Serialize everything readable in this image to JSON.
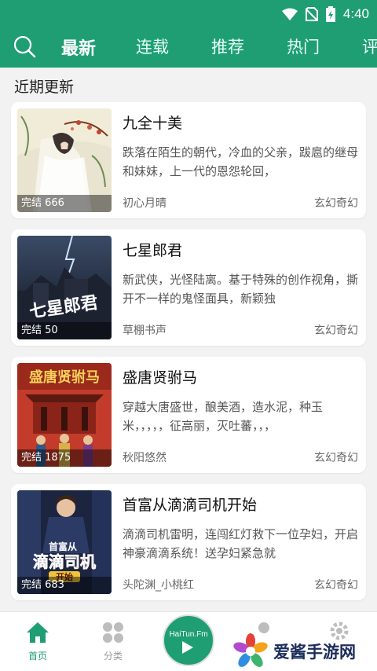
{
  "status": {
    "time": "4:40"
  },
  "nav": {
    "tabs": [
      "最新",
      "连载",
      "推荐",
      "热门",
      "评"
    ],
    "active": 0
  },
  "section_title": "近期更新",
  "books": [
    {
      "title": "九全十美",
      "desc": "跌落在陌生的朝代，冷血的父亲，跋扈的继母和妹妹，上一代的恩怨轮回，",
      "badge": "完结 666",
      "author": "初心月晴",
      "genre": "玄幻奇幻"
    },
    {
      "title": "七星郎君",
      "desc": "新武侠，光怪陆离。基于特殊的创作视角，撕开不一样的鬼怪面具，新颖独",
      "badge": "完结 50",
      "author": "草棚书声",
      "genre": "玄幻奇幻",
      "cover_text": "七星郎君"
    },
    {
      "title": "盛唐贤驸马",
      "desc": "穿越大唐盛世，酿美酒，造水泥，种玉米，，，，，征高丽，灭吐蕃，，，",
      "badge": "完结 1875",
      "author": "秋阳悠然",
      "genre": "玄幻奇幻",
      "cover_text": "盛唐贤驸马"
    },
    {
      "title": "首富从滴滴司机开始",
      "desc": "滴滴司机雷明，连闯红灯救下一位孕妇，开启神豪滴滴系统！送孕妇紧急就",
      "badge": "完结 683",
      "author": "头陀渊_小桃红",
      "genre": "玄幻奇幻",
      "cover_text_top": "首富从",
      "cover_text": "滴滴司机",
      "cover_text_bottom": "开始"
    }
  ],
  "bottom_nav": {
    "home": "首页",
    "category": "分类",
    "fm_label": "HaiTun.Fm"
  },
  "watermark": "爱酱手游网"
}
